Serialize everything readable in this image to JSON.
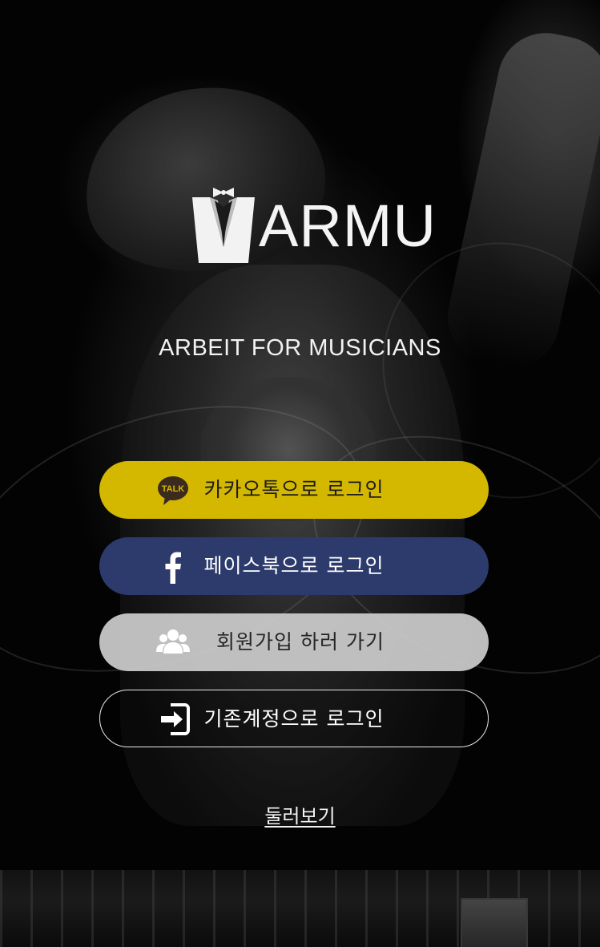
{
  "app": {
    "logo_text": "ARMU",
    "tagline": "ARBEIT FOR MUSICIANS"
  },
  "buttons": {
    "kakao": {
      "label": "카카오톡으로 로그인",
      "icon": "kakao-talk-icon",
      "icon_text": "TALK",
      "color": "#d4b800"
    },
    "facebook": {
      "label": "페이스북으로 로그인",
      "icon": "facebook-icon",
      "color": "#2c3b6c"
    },
    "signup": {
      "label": "회원가입 하러 가기",
      "icon": "users-icon",
      "color": "#cdcdcd"
    },
    "existing": {
      "label": "기존계정으로 로그인",
      "icon": "sign-in-icon"
    }
  },
  "links": {
    "browse": "둘러보기"
  }
}
